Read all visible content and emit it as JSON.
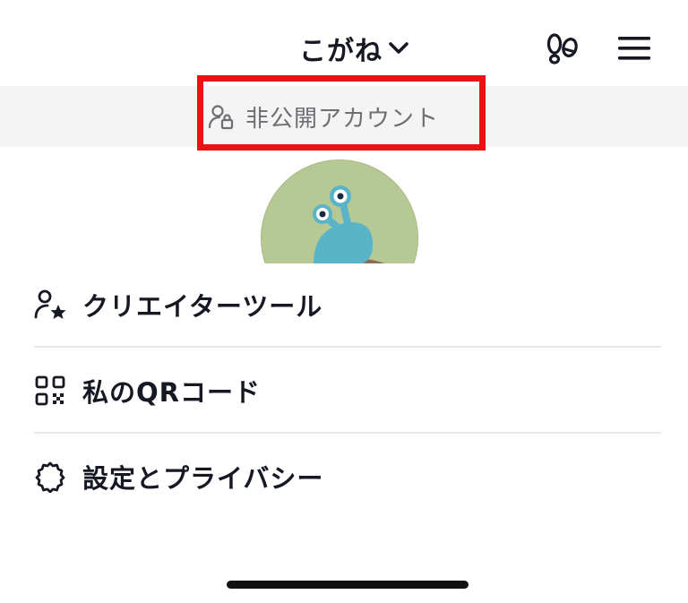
{
  "header": {
    "username": "こがね",
    "username_dropdown_icon": "chevron-down-icon",
    "footprint_icon": "footprints-icon",
    "menu_icon": "hamburger-menu-icon"
  },
  "privacy_banner": {
    "icon": "person-lock-icon",
    "label": "非公開アカウント",
    "highlight_color": "#ee1111"
  },
  "avatar": {
    "description_icon": "snail-avatar"
  },
  "menu": {
    "items": [
      {
        "icon": "person-star-icon",
        "label": "クリエイターツール"
      },
      {
        "icon": "qr-code-icon",
        "label": "私のQRコード"
      },
      {
        "icon": "gear-icon",
        "label": "設定とプライバシー"
      }
    ]
  },
  "colors": {
    "text": "#161823",
    "banner_bg": "#f4f4f4",
    "banner_text": "#6e6e73",
    "divider": "#e8e8e8",
    "highlight": "#ee1111"
  }
}
